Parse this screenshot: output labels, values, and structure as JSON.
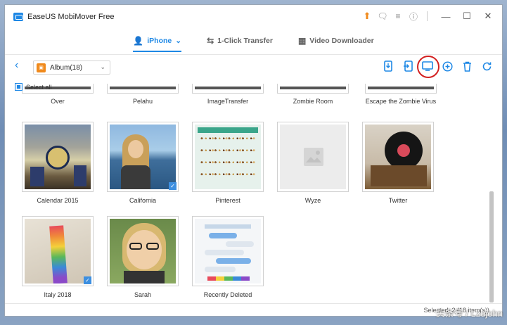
{
  "window": {
    "title": "EaseUS MobiMover Free"
  },
  "titlebar_icons": [
    "upgrade-icon",
    "feedback-icon",
    "menu-icon",
    "info-icon"
  ],
  "window_controls": {
    "minimize": "—",
    "maximize": "☐",
    "close": "✕"
  },
  "nav": {
    "tabs": [
      {
        "label": "iPhone",
        "icon": "phone-user-icon",
        "caret": "⌄",
        "active": true
      },
      {
        "label": "1-Click Transfer",
        "icon": "transfer-icon",
        "active": false
      },
      {
        "label": "Video Downloader",
        "icon": "video-icon",
        "active": false
      }
    ]
  },
  "toolbar": {
    "back": "‹",
    "album": {
      "label": "Album(18)",
      "caret": "⌄"
    },
    "actions": [
      {
        "name": "transfer-to-phone-button",
        "glyph": "▯"
      },
      {
        "name": "transfer-from-phone-button",
        "glyph": "▯"
      },
      {
        "name": "transfer-to-computer-button",
        "glyph": "▭"
      },
      {
        "name": "add-button",
        "glyph": "⊕"
      },
      {
        "name": "delete-button",
        "glyph": "🗑"
      },
      {
        "name": "refresh-button",
        "glyph": "↻"
      }
    ]
  },
  "select_all": {
    "label": "Select all"
  },
  "albums_top_row": [
    "Over",
    "Pelahu",
    "ImageTransfer",
    "Zombie Room",
    "Escape the Zombie Virus"
  ],
  "albums": [
    {
      "name": "Calendar 2015",
      "checked": false
    },
    {
      "name": "California",
      "checked": true
    },
    {
      "name": "Pinterest",
      "checked": false
    },
    {
      "name": "Wyze",
      "checked": false
    },
    {
      "name": "Twitter",
      "checked": false
    },
    {
      "name": "Italy 2018",
      "checked": true
    },
    {
      "name": "Sarah",
      "checked": false
    },
    {
      "name": "Recently Deleted",
      "checked": false
    }
  ],
  "status": {
    "text": "Selected: 2 (18 item(s))"
  },
  "watermark": "头条号 / Lzujohn",
  "colors": {
    "accent": "#1e88e5",
    "highlight_circle": "#d32020",
    "upgrade": "#f08a1c"
  }
}
